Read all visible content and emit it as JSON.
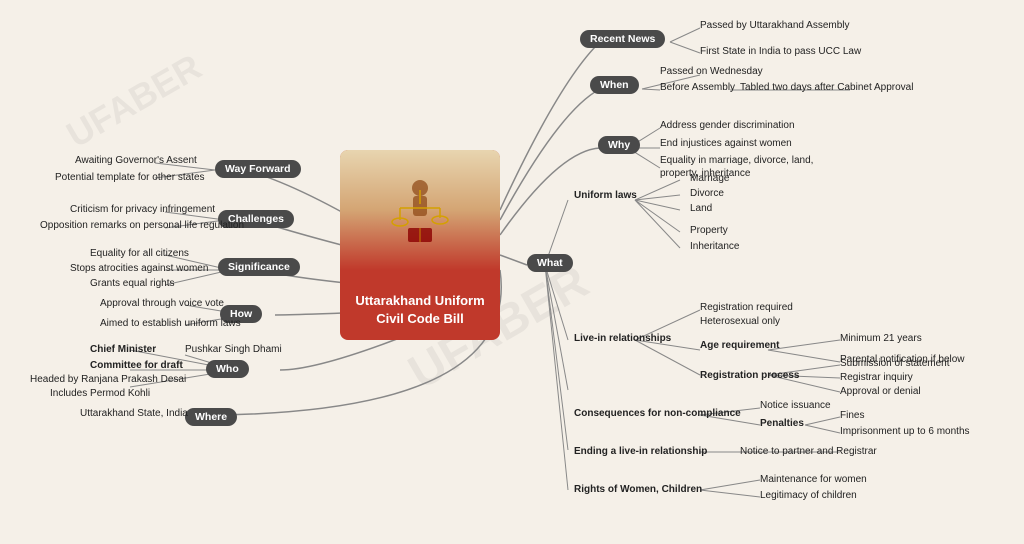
{
  "title": "Uttarakhand Uniform Civil Code Bill",
  "nodes": {
    "center": "Uttarakhand\nUniform Civil\nCode Bill",
    "recentNews": "Recent News",
    "when": "When",
    "why": "Why",
    "what": "What",
    "where": "Where",
    "who": "Who",
    "how": "How",
    "significance": "Significance",
    "challenges": "Challenges",
    "wayForward": "Way Forward"
  },
  "labels": {
    "recentNews1": "Passed by Uttarakhand Assembly",
    "recentNews2": "First State in India to pass UCC Law",
    "when1": "Passed on Wednesday",
    "when2": "Before Assembly",
    "when3": "Tabled two days after Cabinet Approval",
    "why1": "Address gender discrimination",
    "why2": "End injustices against women",
    "why3": "Equality in marriage, divorce, land,",
    "why4": "property, inheritance",
    "uniformLaws": "Uniform laws",
    "marriage": "Marriage",
    "divorce": "Divorce",
    "land": "Land",
    "property": "Property",
    "inheritance": "Inheritance",
    "liveIn": "Live-in relationships",
    "regRequired": "Registration required",
    "hetero": "Heterosexual only",
    "ageReq": "Age requirement",
    "min21": "Minimum 21 years",
    "parental": "Parental notification if below",
    "regProcess": "Registration process",
    "submission": "Submission of statement",
    "registrar": "Registrar inquiry",
    "approvalDenial": "Approval or denial",
    "consequences": "Consequences for non-compliance",
    "noticeIssuance": "Notice issuance",
    "penalties": "Penalties",
    "fines": "Fines",
    "imprisonment": "Imprisonment up to 6 months",
    "endingLiveIn": "Ending a live-in relationship",
    "noticePartner": "Notice to partner and Registrar",
    "rightsWomen": "Rights of Women, Children",
    "maintenance": "Maintenance for women",
    "legitimacy": "Legitimacy of children",
    "where1": "Uttarakhand State, India",
    "chiefMinister": "Chief Minister",
    "pushkar": "Pushkar Singh Dhami",
    "committee": "Committee for draft",
    "headed": "Headed by Ranjana Prakash Desai",
    "includes": "Includes Permod Kohli",
    "how1": "Approval through voice vote",
    "how2": "Aimed to establish uniform laws",
    "sig1": "Equality for all citizens",
    "sig2": "Stops atrocities against women",
    "sig3": "Grants equal rights",
    "chal1": "Criticism for privacy infringement",
    "chal2": "Opposition remarks on personal life regulation",
    "wf1": "Awaiting Governor's Assent",
    "wf2": "Potential template for other states"
  }
}
